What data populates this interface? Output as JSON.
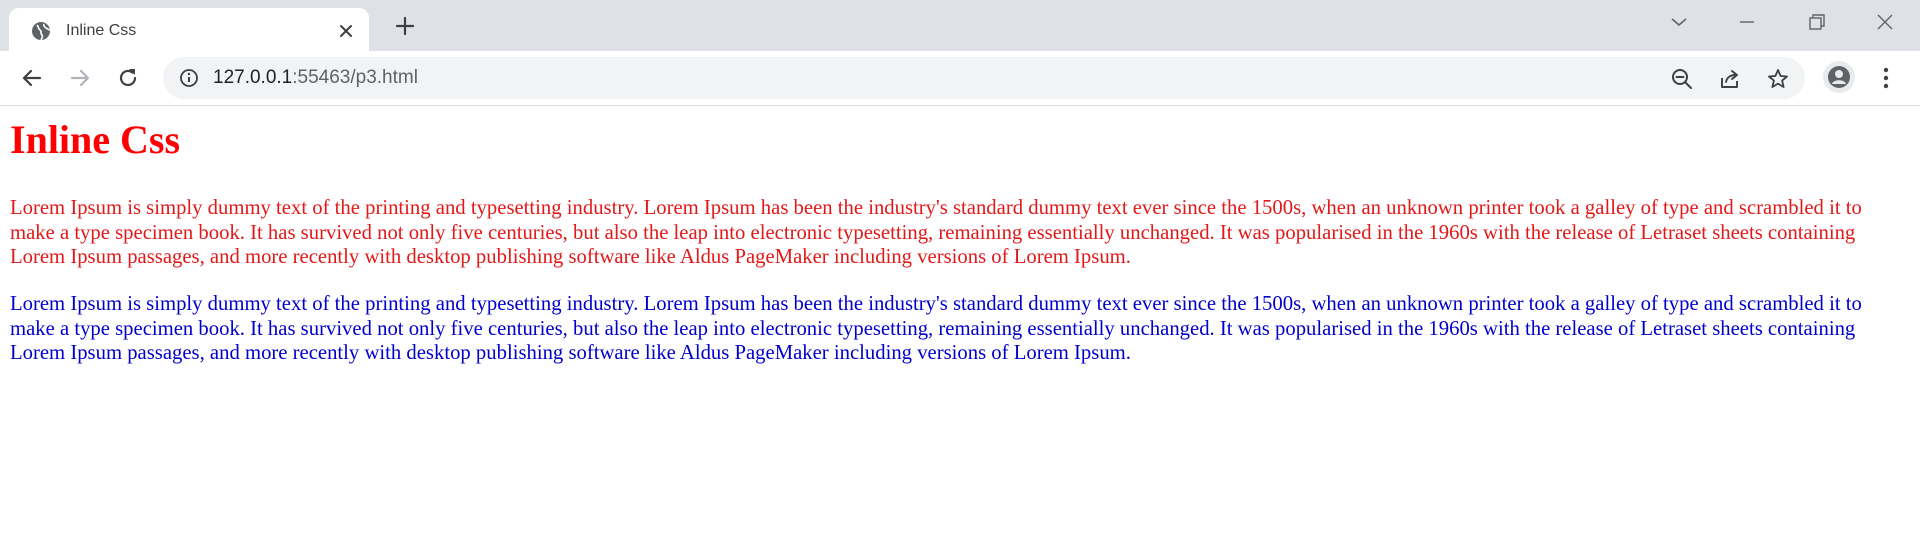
{
  "browser": {
    "tab": {
      "title": "Inline Css",
      "favicon_icon": "globe-icon"
    },
    "address_bar": {
      "host": "127.0.0.1",
      "rest": ":55463/p3.html"
    },
    "colors": {
      "tabstrip": "#dee1e6",
      "omnibox": "#f1f3f4",
      "icon": "#5f6368"
    }
  },
  "page": {
    "heading": "Inline Css",
    "paragraphs": [
      {
        "text": "Lorem Ipsum is simply dummy text of the printing and typesetting industry. Lorem Ipsum has been the industry's standard dummy text ever since the 1500s, when an unknown printer took a galley of type and scrambled it to make a type specimen book. It has survived not only five centuries, but also the leap into electronic typesetting, remaining essentially unchanged. It was popularised in the 1960s with the release of Letraset sheets containing Lorem Ipsum passages, and more recently with desktop publishing software like Aldus PageMaker including versions of Lorem Ipsum.",
        "color": "#e11919"
      },
      {
        "text": "Lorem Ipsum is simply dummy text of the printing and typesetting industry. Lorem Ipsum has been the industry's standard dummy text ever since the 1500s, when an unknown printer took a galley of type and scrambled it to make a type specimen book. It has survived not only five centuries, but also the leap into electronic typesetting, remaining essentially unchanged. It was popularised in the 1960s with the release of Letraset sheets containing Lorem Ipsum passages, and more recently with desktop publishing software like Aldus PageMaker including versions of Lorem Ipsum.",
        "color": "#0000cc"
      }
    ],
    "heading_color": "#ff0000"
  }
}
